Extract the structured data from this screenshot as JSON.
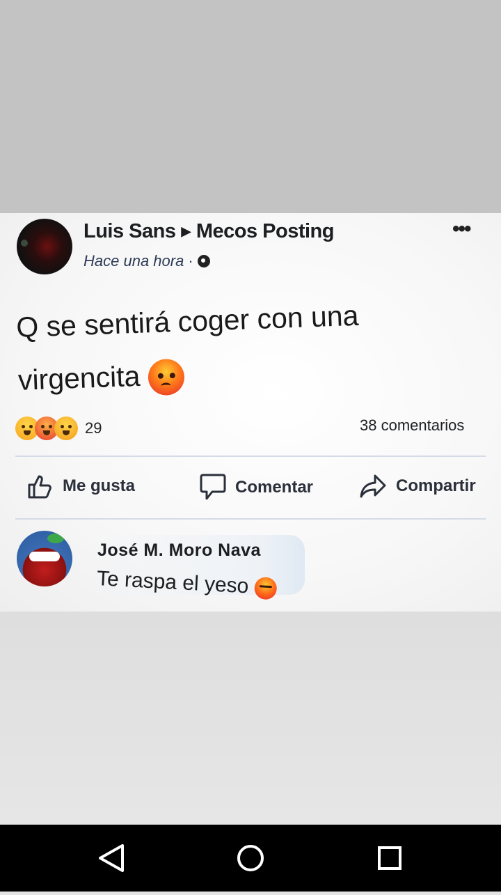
{
  "post": {
    "author": "Luis Sans",
    "group": "Mecos Posting",
    "time": "Hace una hora",
    "text": "Q se sentirá coger con una virgencita",
    "reactions_count": "29",
    "comments_count": "38 comentarios"
  },
  "actions": {
    "like": "Me gusta",
    "comment": "Comentar",
    "share": "Compartir"
  },
  "comment": {
    "name": "José M. Moro Nava",
    "text": "Te raspa el yeso"
  },
  "icons": {
    "more": "more-options-icon",
    "privacy": "globe-icon",
    "reactions": [
      "haha-reaction-icon",
      "angry-reaction-icon",
      "wow-reaction-icon"
    ],
    "nav": [
      "back-icon",
      "home-icon",
      "recents-icon"
    ]
  },
  "colors": {
    "navbar": "#000000",
    "post_background": "#ffffff",
    "text": "#1c1e21"
  }
}
